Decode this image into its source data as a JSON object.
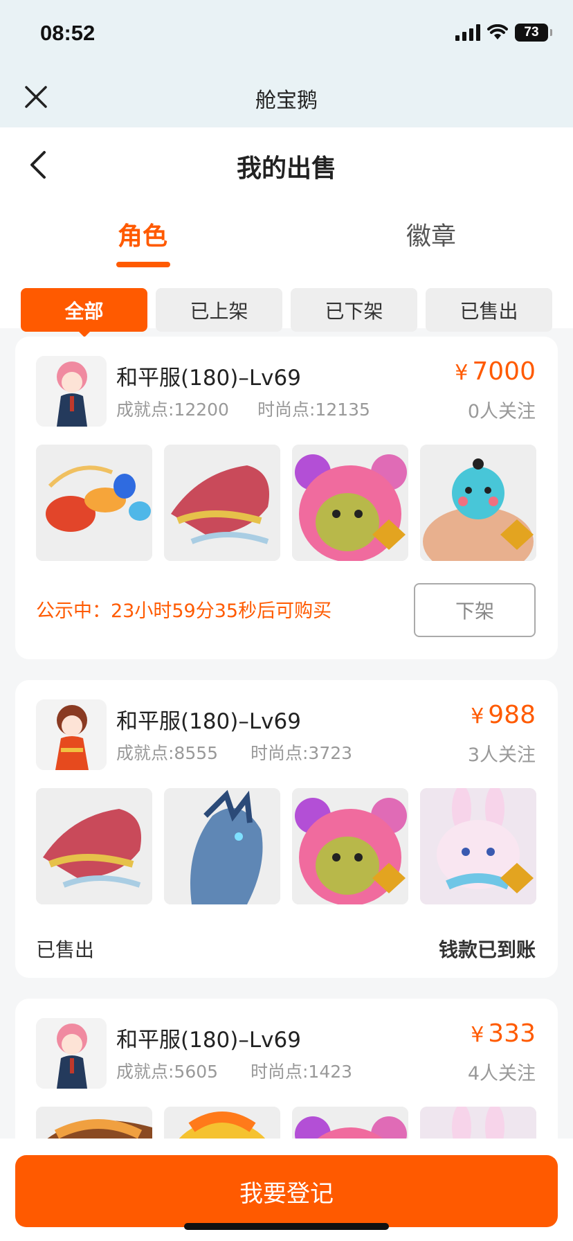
{
  "status_bar": {
    "time": "08:52",
    "battery": "73"
  },
  "mini_app": {
    "title": "舱宝鹅"
  },
  "page": {
    "title": "我的出售"
  },
  "tabs": [
    {
      "label": "角色",
      "active": true
    },
    {
      "label": "徽章",
      "active": false
    }
  ],
  "filters": [
    {
      "label": "全部",
      "active": true
    },
    {
      "label": "已上架",
      "active": false
    },
    {
      "label": "已下架",
      "active": false
    },
    {
      "label": "已售出",
      "active": false
    }
  ],
  "listings": [
    {
      "title": "和平服(180)–Lv69",
      "achievement": "成就点:12200",
      "fashion": "时尚点:12135",
      "currency": "¥",
      "price": "7000",
      "followers": "0人关注",
      "notice": "公示中：23小时59分35秒后可购买",
      "action_label": "下架"
    },
    {
      "title": "和平服(180)–Lv69",
      "achievement": "成就点:8555",
      "fashion": "时尚点:3723",
      "currency": "¥",
      "price": "988",
      "followers": "3人关注",
      "status": "已售出",
      "payment_status": "钱款已到账"
    },
    {
      "title": "和平服(180)–Lv69",
      "achievement": "成就点:5605",
      "fashion": "时尚点:1423",
      "currency": "¥",
      "price": "333",
      "followers": "4人关注"
    }
  ],
  "footer": {
    "register_label": "我要登记"
  },
  "colors": {
    "accent": "#ff5a00",
    "header_bg": "#e9f2f5",
    "page_bg": "#f5f6f7"
  }
}
